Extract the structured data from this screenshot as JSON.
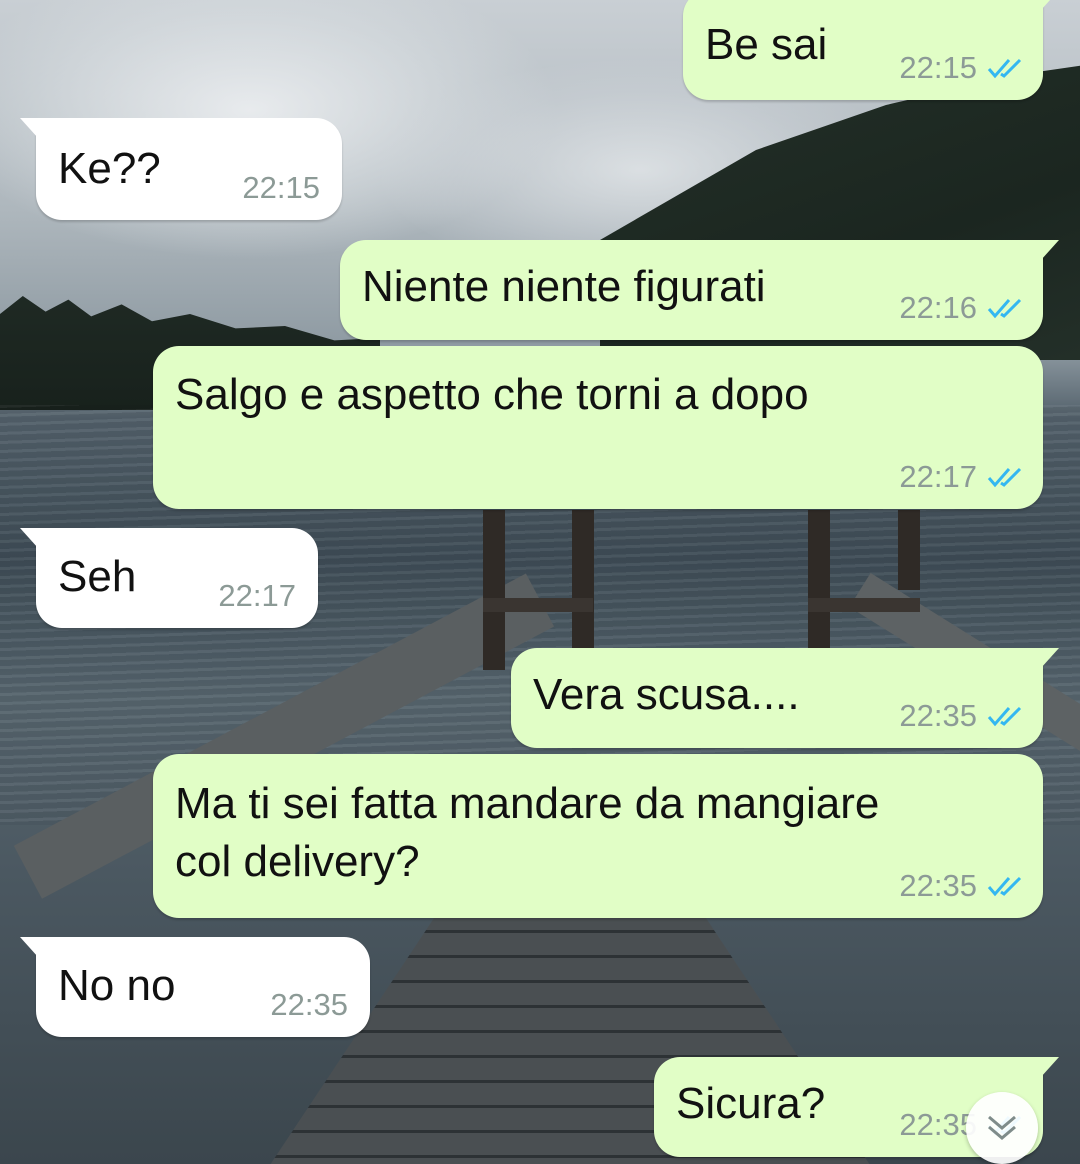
{
  "chat": {
    "messages": [
      {
        "direction": "out",
        "text": "Be sai",
        "time": "22:15",
        "status": "read"
      },
      {
        "direction": "in",
        "text": "Ke??",
        "time": "22:15"
      },
      {
        "direction": "out",
        "text": "Niente niente figurati",
        "time": "22:16",
        "status": "read"
      },
      {
        "direction": "out",
        "text": "Salgo e aspetto che torni a dopo",
        "time": "22:17",
        "status": "read"
      },
      {
        "direction": "in",
        "text": "Seh",
        "time": "22:17"
      },
      {
        "direction": "out",
        "text": "Vera scusa....",
        "time": "22:35",
        "status": "read"
      },
      {
        "direction": "out",
        "text": "Ma ti sei fatta mandare da mangiare\ncol delivery?",
        "time": "22:35",
        "status": "read"
      },
      {
        "direction": "in",
        "text": "No no",
        "time": "22:35"
      },
      {
        "direction": "out",
        "text": "Sicura?",
        "time": "22:35",
        "status": "read"
      }
    ],
    "scroll_button_icon": "double-chevron-down-icon"
  },
  "colors": {
    "outgoing_bubble": "#e1fec6",
    "incoming_bubble": "#ffffff",
    "timestamp": "#8c9a96",
    "read_ticks": "#34b7f1"
  }
}
